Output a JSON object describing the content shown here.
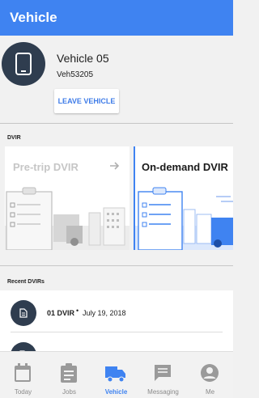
{
  "appbar": {
    "title": "Vehicle"
  },
  "vehicle": {
    "name": "Vehicle 05",
    "id": "Veh53205",
    "leave_label": "LEAVE VEHICLE",
    "avatar_icon": "phone-icon"
  },
  "dvir": {
    "section_label": "DVIR",
    "cards": [
      {
        "title": "Pre-trip DVIR",
        "arrow_icon": "arrow-right-icon",
        "state": "disabled"
      },
      {
        "title": "On-demand DVIR",
        "state": "active"
      }
    ]
  },
  "recent": {
    "section_label": "Recent DVIRs",
    "items": [
      {
        "name": "01 DVIR",
        "separator": "•",
        "date": "July 19, 2018",
        "icon": "document-icon"
      },
      {
        "name": "",
        "separator": "",
        "date": "",
        "icon": "document-icon"
      }
    ]
  },
  "bottom_nav": {
    "items": [
      {
        "label": "Today",
        "icon": "calendar-icon"
      },
      {
        "label": "Jobs",
        "icon": "clipboard-icon"
      },
      {
        "label": "Vehicle",
        "icon": "truck-icon",
        "active": true
      },
      {
        "label": "Messaging",
        "icon": "message-icon"
      },
      {
        "label": "Me",
        "icon": "account-icon"
      }
    ]
  },
  "colors": {
    "primary": "#3f83f1",
    "avatar_bg": "#2f3d4f",
    "inactive": "#8a8a8a",
    "disabled_text": "#c6c6c6"
  }
}
